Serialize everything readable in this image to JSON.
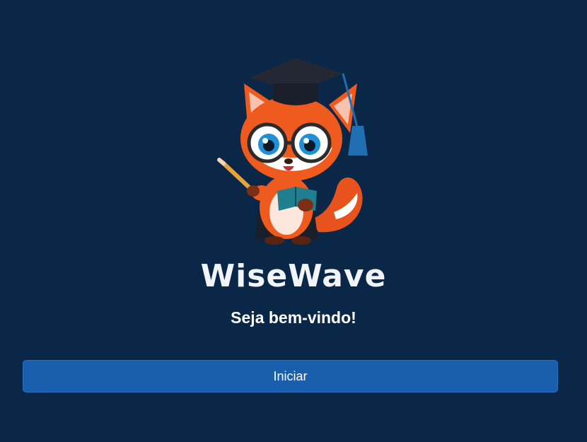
{
  "app": {
    "title": "WiseWave",
    "welcome": "Seja bem-vindo!",
    "mascot_icon": "fox-graduate-mascot-icon"
  },
  "actions": {
    "start_label": "Iniciar"
  },
  "colors": {
    "background": "#0a2748",
    "button": "#1a5fad",
    "title": "#f1f4f8"
  }
}
